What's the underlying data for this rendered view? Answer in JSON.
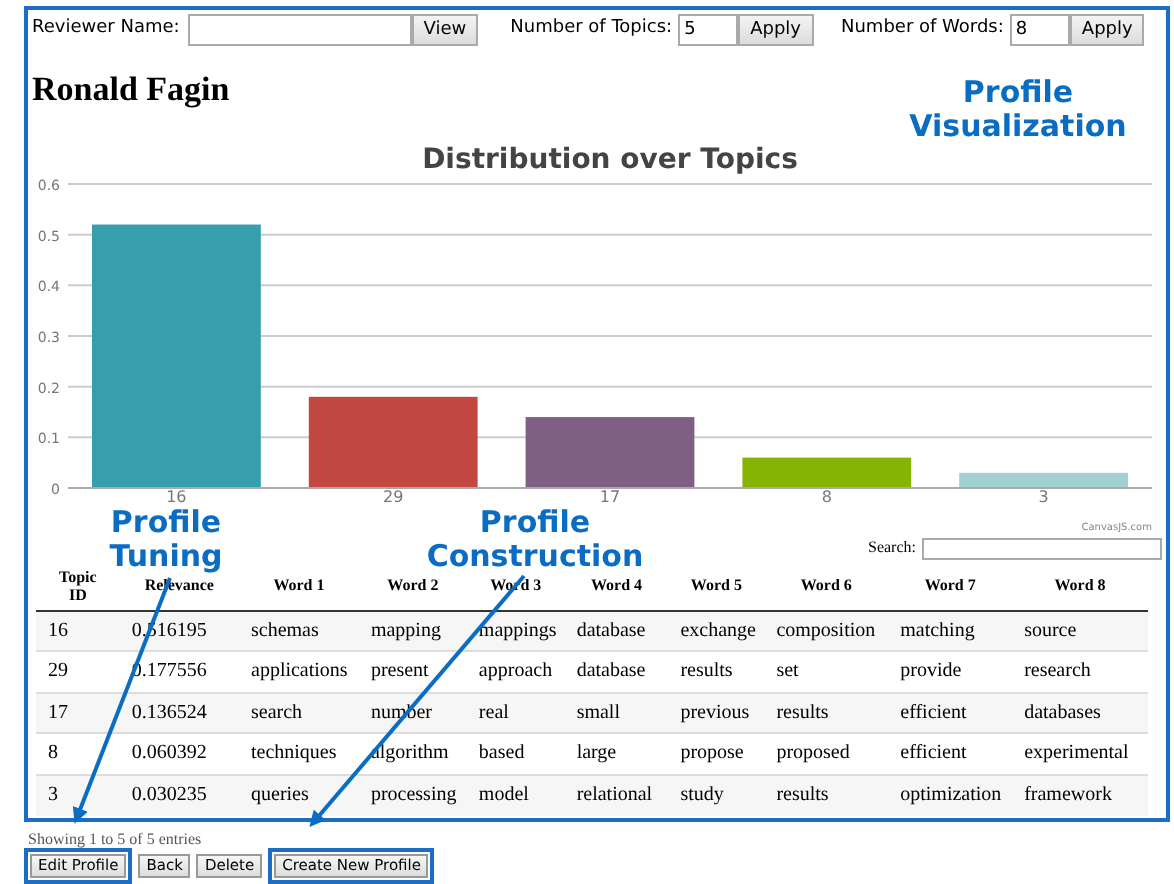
{
  "toolbar": {
    "reviewer_label": "Reviewer Name:",
    "view_button": "View",
    "topics_label": "Number of Topics:",
    "topics_value": "5",
    "topics_apply": "Apply",
    "words_label": "Number of Words:",
    "words_value": "8",
    "words_apply": "Apply"
  },
  "reviewer_name": "Ronald Fagin",
  "chart": {
    "chart_data": {
      "type": "bar",
      "title": "Distribution over Topics",
      "categories": [
        "16",
        "29",
        "17",
        "8",
        "3"
      ],
      "series": [
        {
          "color": "#369ead",
          "values": [
            0.52,
            null,
            null,
            null,
            null
          ]
        },
        {
          "color": "#c24642",
          "values": [
            null,
            0.18,
            null,
            null,
            null
          ]
        },
        {
          "color": "#7f6084",
          "values": [
            null,
            null,
            0.14,
            null,
            null
          ]
        },
        {
          "color": "#86b402",
          "values": [
            null,
            null,
            null,
            0.06,
            null
          ]
        },
        {
          "color": "#a2d1cf",
          "values": [
            null,
            null,
            null,
            null,
            0.03
          ]
        }
      ],
      "grid": true,
      "ylim": [
        0,
        0.6
      ],
      "yticks": [
        {
          "value": 0,
          "label": "0"
        },
        {
          "value": 0.1,
          "label": "0.1"
        },
        {
          "value": 0.2,
          "label": "0.2"
        },
        {
          "value": 0.3,
          "label": "0.3"
        },
        {
          "value": 0.4,
          "label": "0.4"
        },
        {
          "value": 0.5,
          "label": "0.5"
        },
        {
          "value": 0.6,
          "label": "0.6"
        }
      ]
    },
    "credit": "CanvasJS.com"
  },
  "search": {
    "label": "Search:"
  },
  "table": {
    "columns": [
      "Topic ID",
      "Relevance",
      "Word 1",
      "Word 2",
      "Word 3",
      "Word 4",
      "Word 5",
      "Word 6",
      "Word 7",
      "Word 8"
    ],
    "rows": [
      [
        "16",
        "0.516195",
        "schemas",
        "mapping",
        "mappings",
        "database",
        "exchange",
        "composition",
        "matching",
        "source"
      ],
      [
        "29",
        "0.177556",
        "applications",
        "present",
        "approach",
        "database",
        "results",
        "set",
        "provide",
        "research"
      ],
      [
        "17",
        "0.136524",
        "search",
        "number",
        "real",
        "small",
        "previous",
        "results",
        "efficient",
        "databases"
      ],
      [
        "8",
        "0.060392",
        "techniques",
        "algorithm",
        "based",
        "large",
        "propose",
        "proposed",
        "efficient",
        "experimental"
      ],
      [
        "3",
        "0.030235",
        "queries",
        "processing",
        "model",
        "relational",
        "study",
        "results",
        "optimization",
        "framework"
      ]
    ]
  },
  "footer": {
    "info": "Showing 1 to 5 of 5 entries",
    "buttons": [
      {
        "label": "Edit Profile",
        "highlighted": true
      },
      {
        "label": "Back",
        "highlighted": false
      },
      {
        "label": "Delete",
        "highlighted": false
      },
      {
        "label": "Create New Profile",
        "highlighted": true
      }
    ]
  },
  "callouts": [
    {
      "text": "Profile Visualization",
      "kind": "label"
    },
    {
      "text": "Profile Tuning",
      "kind": "arrow"
    },
    {
      "text": "Profile Construction",
      "kind": "arrow"
    }
  ]
}
